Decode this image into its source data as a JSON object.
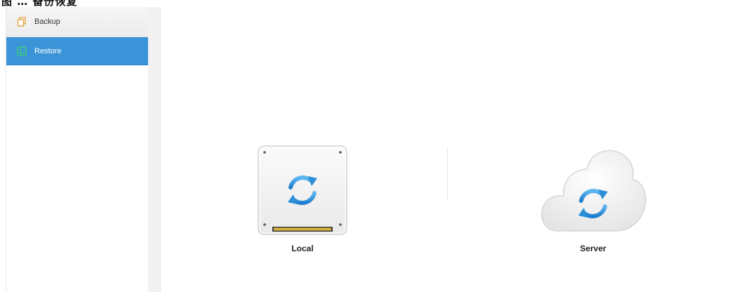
{
  "caption": {
    "text": "图 … 备份恢复"
  },
  "sidebar": {
    "items": [
      {
        "label": "Backup",
        "icon": "copy-icon",
        "selected": false,
        "icon_color": "#e8a23a"
      },
      {
        "label": "Restore",
        "icon": "shield-icon",
        "selected": true,
        "icon_color": "#3fd07a"
      }
    ],
    "accent": "#3c94d8"
  },
  "main": {
    "options": [
      {
        "label": "Local",
        "icon": "local-disk-sync-icon"
      },
      {
        "label": "Server",
        "icon": "cloud-sync-icon"
      }
    ],
    "sync_color": "#2a8fd6"
  }
}
